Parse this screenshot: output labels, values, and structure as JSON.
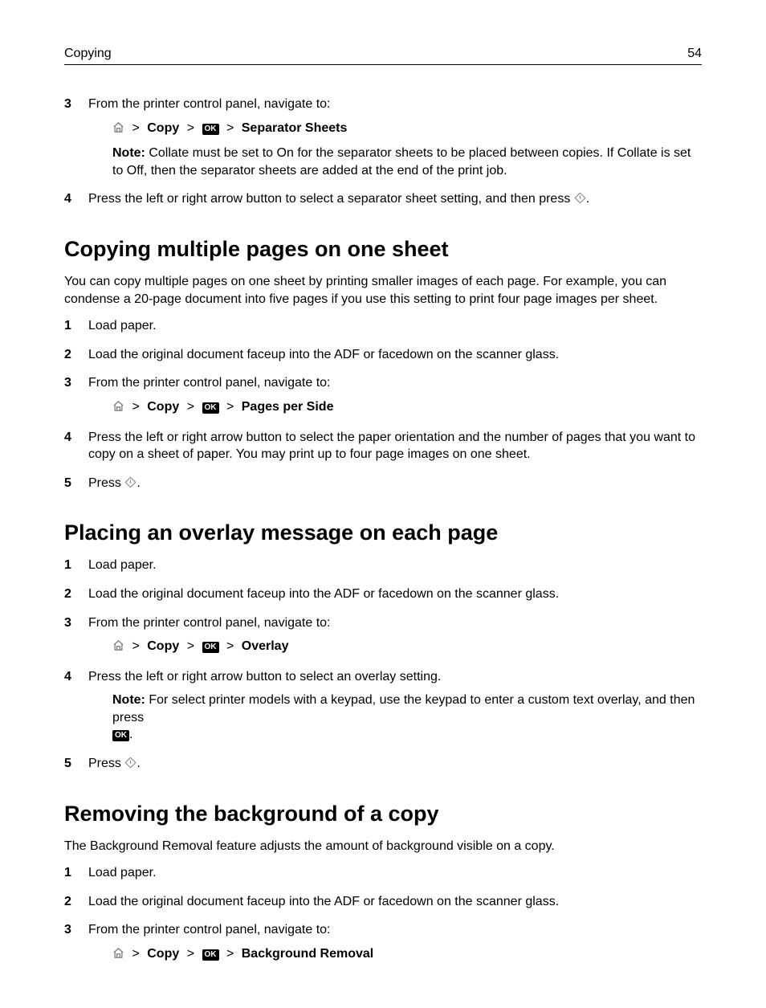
{
  "header": {
    "left": "Copying",
    "right": "54"
  },
  "icons": {
    "ok_text": "OK"
  },
  "top_section": {
    "step3": {
      "num": "3",
      "text": "From the printer control panel, navigate to:",
      "nav_copy": "Copy",
      "nav_target": "Separator Sheets",
      "note_label": "Note:",
      "note_text": " Collate must be set to On for the separator sheets to be placed between copies. If Collate is set to Off, then the separator sheets are added at the end of the print job."
    },
    "step4": {
      "num": "4",
      "text_before": "Press the left or right arrow button to select a separator sheet setting, and then press ",
      "text_after": "."
    }
  },
  "sectionA": {
    "title": "Copying multiple pages on one sheet",
    "intro": "You can copy multiple pages on one sheet by printing smaller images of each page. For example, you can condense a 20-page document into five pages if you use this setting to print four page images per sheet.",
    "steps": {
      "s1": {
        "num": "1",
        "text": "Load paper."
      },
      "s2": {
        "num": "2",
        "text": "Load the original document faceup into the ADF or facedown on the scanner glass."
      },
      "s3": {
        "num": "3",
        "text": "From the printer control panel, navigate to:",
        "nav_copy": "Copy",
        "nav_target": "Pages per Side"
      },
      "s4": {
        "num": "4",
        "text": "Press the left or right arrow button to select the paper orientation and the number of pages that you want to copy on a sheet of paper. You may print up to four page images on one sheet."
      },
      "s5": {
        "num": "5",
        "text_before": "Press ",
        "text_after": "."
      }
    }
  },
  "sectionB": {
    "title": "Placing an overlay message on each page",
    "steps": {
      "s1": {
        "num": "1",
        "text": "Load paper."
      },
      "s2": {
        "num": "2",
        "text": "Load the original document faceup into the ADF or facedown on the scanner glass."
      },
      "s3": {
        "num": "3",
        "text": "From the printer control panel, navigate to:",
        "nav_copy": "Copy",
        "nav_target": "Overlay"
      },
      "s4": {
        "num": "4",
        "text": "Press the left or right arrow button to select an overlay setting.",
        "note_label": "Note:",
        "note_text_before": " For select printer models with a keypad, use the keypad to enter a custom text overlay, and then press ",
        "note_text_after": "."
      },
      "s5": {
        "num": "5",
        "text_before": "Press ",
        "text_after": "."
      }
    }
  },
  "sectionC": {
    "title": "Removing the background of a copy",
    "intro": "The Background Removal feature adjusts the amount of background visible on a copy.",
    "steps": {
      "s1": {
        "num": "1",
        "text": "Load paper."
      },
      "s2": {
        "num": "2",
        "text": "Load the original document faceup into the ADF or facedown on the scanner glass."
      },
      "s3": {
        "num": "3",
        "text": "From the printer control panel, navigate to:",
        "nav_copy": "Copy",
        "nav_target": "Background Removal"
      }
    }
  }
}
